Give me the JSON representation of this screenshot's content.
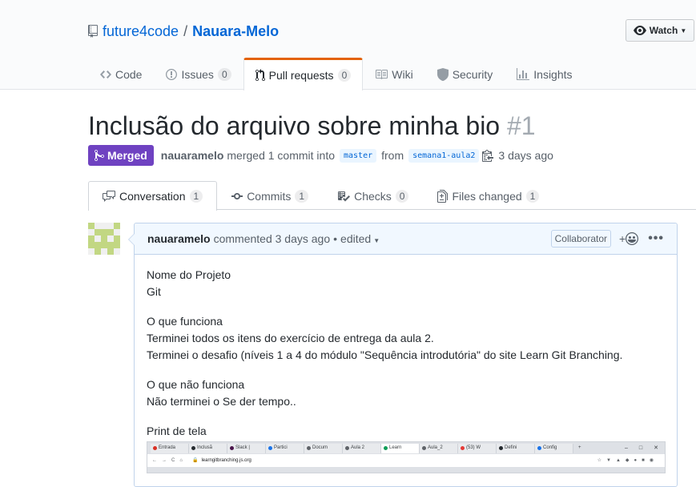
{
  "repo": {
    "owner": "future4code",
    "separator": "/",
    "name": "Nauara-Melo"
  },
  "watch": {
    "label": "Watch"
  },
  "reponav": [
    {
      "label": "Code",
      "icon": "code-icon",
      "count": null
    },
    {
      "label": "Issues",
      "icon": "issue-icon",
      "count": "0"
    },
    {
      "label": "Pull requests",
      "icon": "pull-request-icon",
      "count": "0",
      "selected": true
    },
    {
      "label": "Wiki",
      "icon": "book-icon",
      "count": null
    },
    {
      "label": "Security",
      "icon": "shield-icon",
      "count": null
    },
    {
      "label": "Insights",
      "icon": "graph-icon",
      "count": null
    }
  ],
  "pr": {
    "title": "Inclusão do arquivo sobre minha bio",
    "number": "#1",
    "state": "Merged",
    "author": "nauaramelo",
    "merged_text": "merged 1 commit into",
    "base_branch": "master",
    "from_text": "from",
    "head_branch": "semana1-aula2",
    "time": "3 days ago"
  },
  "tabs": [
    {
      "label": "Conversation",
      "icon": "comment-discussion-icon",
      "count": "1",
      "selected": true
    },
    {
      "label": "Commits",
      "icon": "commit-icon",
      "count": "1"
    },
    {
      "label": "Checks",
      "icon": "checklist-icon",
      "count": "0"
    },
    {
      "label": "Files changed",
      "icon": "diff-icon",
      "count": "1"
    }
  ],
  "comment": {
    "author": "nauaramelo",
    "meta": "commented 3 days ago",
    "dot": "•",
    "edited": "edited",
    "badge": "Collaborator",
    "react_plus": "+",
    "more": "•••",
    "body": [
      [
        "Nome do Projeto",
        "Git"
      ],
      [
        "O que funciona",
        "Terminei todos os itens do exercício de entrega da aula 2.",
        "Terminei o desafio (níveis 1 a 4 do módulo \"Sequência introdutória\" do site Learn Git Branching."
      ],
      [
        "O que não funciona",
        "Não terminei o Se der tempo.."
      ],
      [
        "Print de tela"
      ]
    ]
  },
  "screenshot": {
    "tabs": [
      "Entrada",
      "Inclusã",
      "Slack |",
      "Partici",
      "Docum",
      "Aula 2",
      "Learn",
      "Aula_2",
      "(53) W",
      "Defini",
      "Config"
    ],
    "url": "learngitbranching.js.org",
    "tab_colors": [
      "#d93025",
      "#24292e",
      "#4a154b",
      "#1a73e8",
      "#5f6368",
      "#5f6368",
      "#0f9d58",
      "#5f6368",
      "#e53935",
      "#24292e",
      "#1a73e8"
    ]
  }
}
